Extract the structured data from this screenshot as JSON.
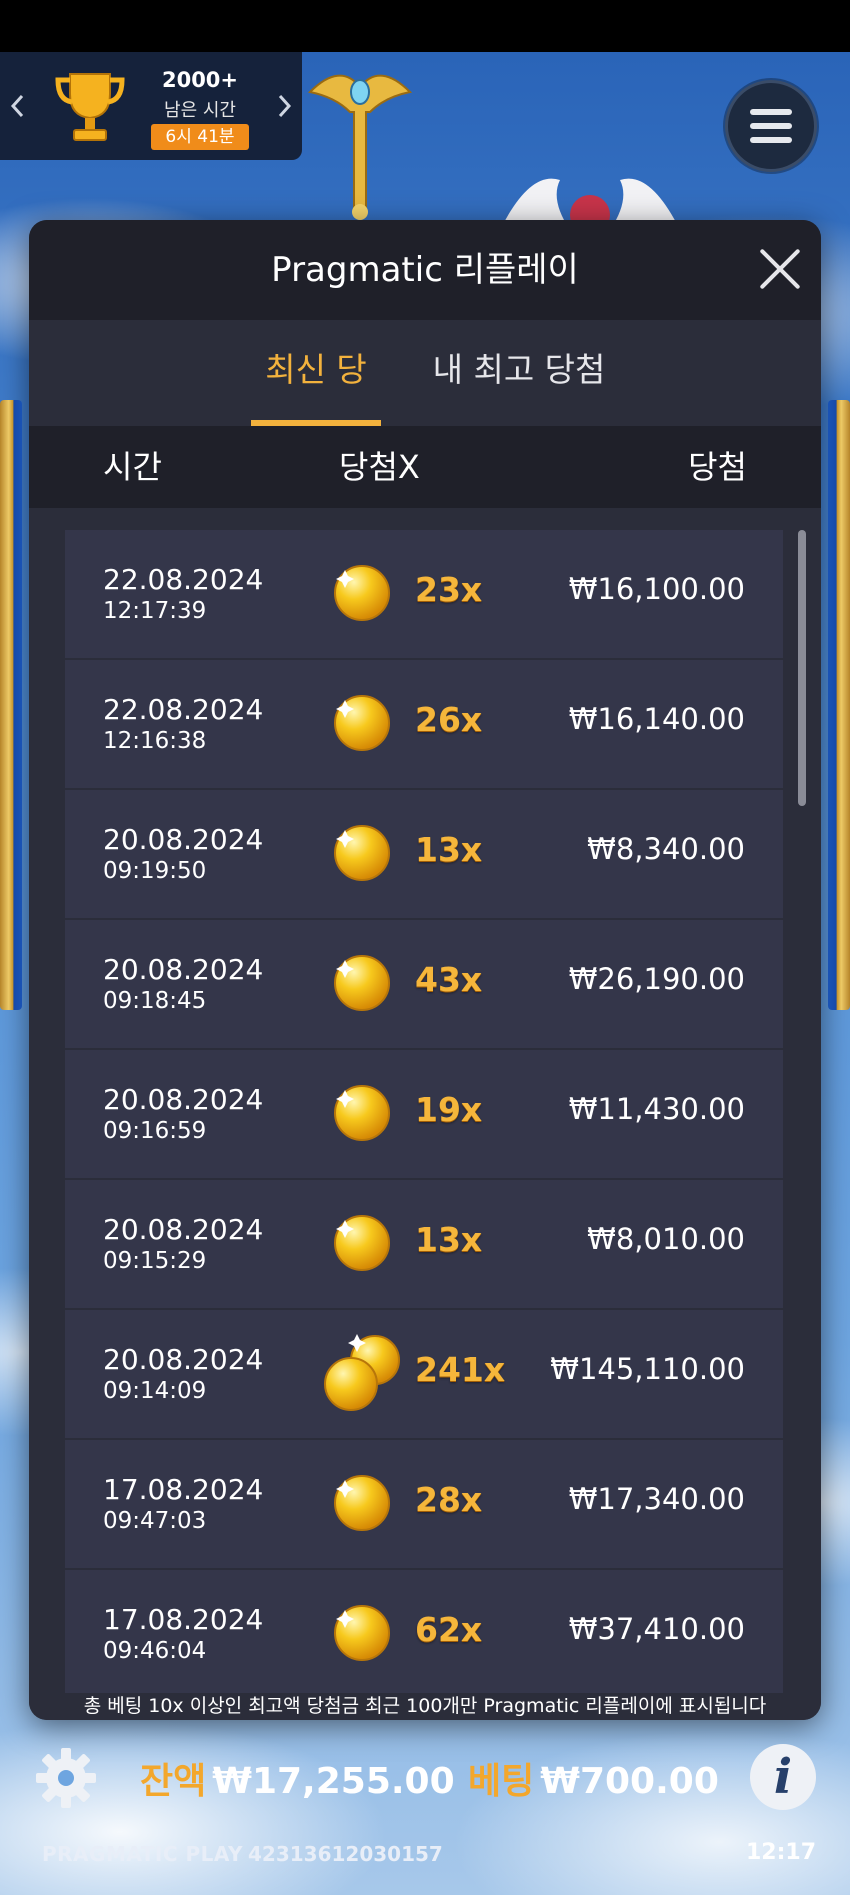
{
  "tournament": {
    "count": "2000+",
    "remaining_label": "남은 시간",
    "timer": "6시 41분"
  },
  "modal": {
    "title": "Pragmatic 리플레이",
    "tabs": [
      {
        "label": "최신 당첨",
        "active": true
      },
      {
        "label": "내 최고 당첨",
        "active": false
      }
    ],
    "columns": {
      "time": "시간",
      "multiplier": "당첨X",
      "win": "당첨"
    },
    "rows": [
      {
        "date": "22.08.2024",
        "time": "12:17:39",
        "multiplier": "23x",
        "win": "₩16,100.00",
        "icon": "single-coin-icon"
      },
      {
        "date": "22.08.2024",
        "time": "12:16:38",
        "multiplier": "26x",
        "win": "₩16,140.00",
        "icon": "single-coin-icon"
      },
      {
        "date": "20.08.2024",
        "time": "09:19:50",
        "multiplier": "13x",
        "win": "₩8,340.00",
        "icon": "single-coin-icon"
      },
      {
        "date": "20.08.2024",
        "time": "09:18:45",
        "multiplier": "43x",
        "win": "₩26,190.00",
        "icon": "single-coin-icon"
      },
      {
        "date": "20.08.2024",
        "time": "09:16:59",
        "multiplier": "19x",
        "win": "₩11,430.00",
        "icon": "single-coin-icon"
      },
      {
        "date": "20.08.2024",
        "time": "09:15:29",
        "multiplier": "13x",
        "win": "₩8,010.00",
        "icon": "single-coin-icon"
      },
      {
        "date": "20.08.2024",
        "time": "09:14:09",
        "multiplier": "241x",
        "win": "₩145,110.00",
        "icon": "double-coin-icon"
      },
      {
        "date": "17.08.2024",
        "time": "09:47:03",
        "multiplier": "28x",
        "win": "₩17,340.00",
        "icon": "single-coin-icon"
      },
      {
        "date": "17.08.2024",
        "time": "09:46:04",
        "multiplier": "62x",
        "win": "₩37,410.00",
        "icon": "single-coin-icon"
      }
    ],
    "footnote": "총 베팅 10x 이상인 최고액 당첨금 최근 100개만 Pragmatic 리플레이에 표시됩니다"
  },
  "bottom_bar": {
    "balance_label": "잔액",
    "balance_value": "₩17,255.00",
    "bet_label": "베팅",
    "bet_value": "₩700.00",
    "brand": "PRAGMATIC PLAY",
    "session_id": "42313612030157",
    "clock": "12:17"
  },
  "colors": {
    "accent": "#f3b23d",
    "modal_bg": "#2b2d3a",
    "header_bg": "#1f2029",
    "row_bg": "#34364a"
  }
}
